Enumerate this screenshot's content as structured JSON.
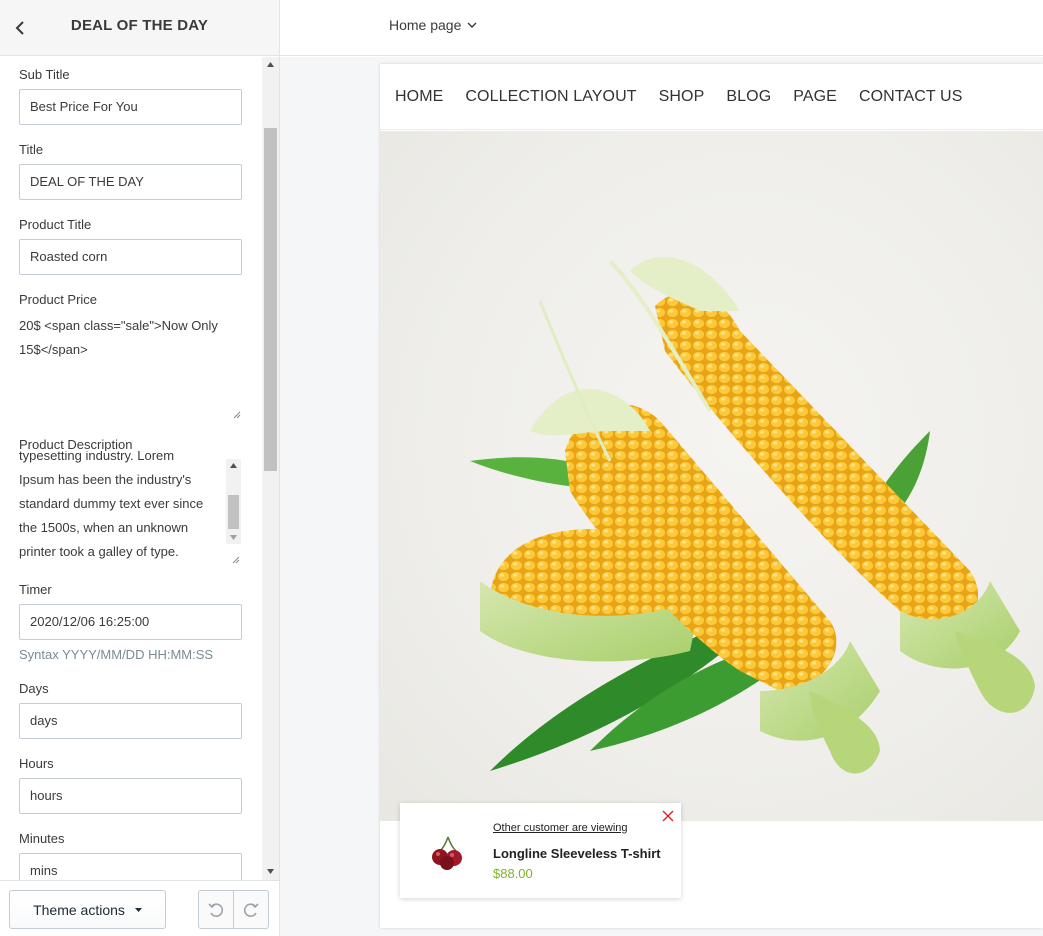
{
  "sidebar": {
    "title": "DEAL OF THE DAY",
    "fields": {
      "sub_title": {
        "label": "Sub Title",
        "value": "Best Price For You"
      },
      "title": {
        "label": "Title",
        "value": "DEAL OF THE DAY"
      },
      "product_title": {
        "label": "Product Title",
        "value": "Roasted corn"
      },
      "product_price": {
        "label": "Product Price",
        "line1": "20$ <span class=\"sale\">Now Only",
        "line2": "15$</span>"
      },
      "product_description": {
        "label": "Product Description",
        "lines": [
          "typesetting industry. Lorem",
          "Ipsum has been the industry's",
          "standard dummy text ever since",
          "the 1500s, when an unknown",
          "printer took a galley of type."
        ]
      },
      "timer": {
        "label": "Timer",
        "value": "2020/12/06 16:25:00",
        "help": "Syntax YYYY/MM/DD HH:MM:SS"
      },
      "days": {
        "label": "Days",
        "value": "days"
      },
      "hours": {
        "label": "Hours",
        "value": "hours"
      },
      "minutes": {
        "label": "Minutes",
        "value": "mins"
      }
    },
    "footer": {
      "theme_actions": "Theme actions"
    }
  },
  "topbar": {
    "page_select": "Home page"
  },
  "preview": {
    "nav": [
      "HOME",
      "COLLECTION LAYOUT",
      "SHOP",
      "BLOG",
      "PAGE",
      "CONTACT US"
    ],
    "popup": {
      "viewing": "Other customer are viewing",
      "product": "Longline Sleeveless T-shirt",
      "price": "$88.00"
    }
  },
  "colors": {
    "accent_green": "#7fb327",
    "close_red": "#e02020",
    "corn_yellow": "#f4b81f",
    "husk_green": "#4caa2e"
  },
  "icons": {
    "back": "chevron-left-icon",
    "page_select": "chevron-down-icon",
    "theme_actions": "caret-down-icon",
    "undo": "undo-icon",
    "redo": "redo-icon",
    "close": "close-icon"
  }
}
